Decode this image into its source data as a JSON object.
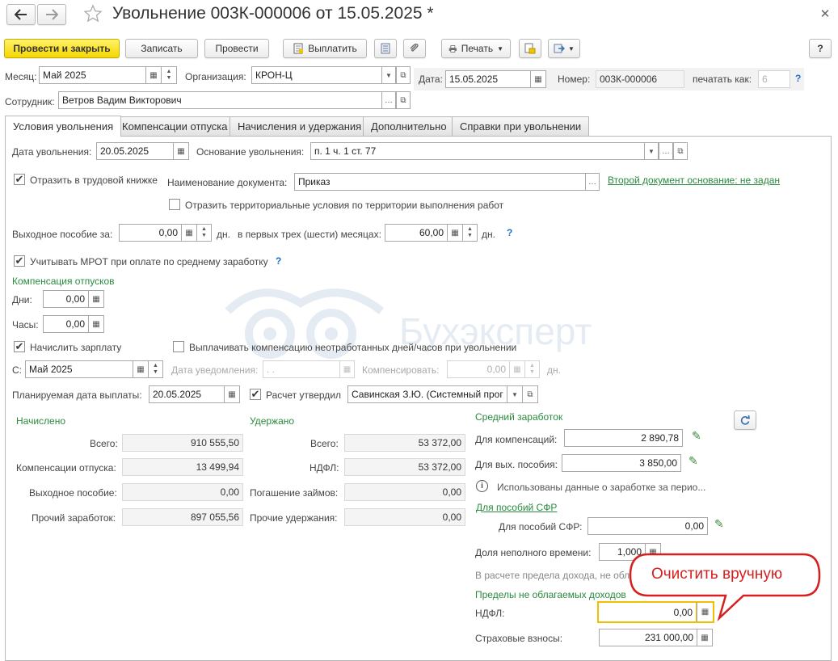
{
  "window": {
    "title": "Увольнение 003К-000006 от 15.05.2025 *"
  },
  "toolbar": {
    "post_close": "Провести и закрыть",
    "save": "Записать",
    "post": "Провести",
    "pay": "Выплатить",
    "print": "Печать",
    "help": "?"
  },
  "header": {
    "month_label": "Месяц:",
    "month_value": "Май 2025",
    "org_label": "Организация:",
    "org_value": "КРОН-Ц",
    "date_label": "Дата:",
    "date_value": "15.05.2025",
    "number_label": "Номер:",
    "number_value": "003К-000006",
    "print_as_label": "печатать как:",
    "print_as_value": "6",
    "help": "?",
    "employee_label": "Сотрудник:",
    "employee_value": "Ветров Вадим Викторович"
  },
  "tabs": [
    {
      "label": "Условия увольнения"
    },
    {
      "label": "Компенсации отпуска"
    },
    {
      "label": "Начисления и удержания"
    },
    {
      "label": "Дополнительно"
    },
    {
      "label": "Справки при увольнении"
    }
  ],
  "conditions": {
    "dismissal_date_label": "Дата увольнения:",
    "dismissal_date_value": "20.05.2025",
    "basis_label": "Основание увольнения:",
    "basis_value": "п. 1 ч. 1 ст. 77",
    "labor_book_label": "Отразить в трудовой книжке",
    "doc_name_label": "Наименование документа:",
    "doc_name_value": "Приказ",
    "second_doc_link": "Второй документ основание: не задан",
    "territorial_label": "Отразить территориальные условия по территории выполнения работ",
    "severance_label": "Выходное пособие за:",
    "severance_value": "0,00",
    "days_unit": "дн.",
    "first_months_label": "в первых трех (шести) месяцах:",
    "first_months_value": "60,00",
    "days_unit2": "дн.",
    "help": "?",
    "mrot_label": "Учитывать МРОТ при оплате по среднему заработку",
    "mrot_help": "?"
  },
  "vacation_comp": {
    "title": "Компенсация отпусков",
    "days_label": "Дни:",
    "days_value": "0,00",
    "hours_label": "Часы:",
    "hours_value": "0,00"
  },
  "salary": {
    "accrue_label": "Начислить зарплату",
    "pay_comp_label": "Выплачивать компенсацию неотработанных дней/часов при увольнении",
    "from_label": "С:",
    "from_value": "Май 2025",
    "notice_date_label": "Дата уведомления:",
    "notice_date_value": " .  .",
    "compensate_label": "Компенсировать:",
    "compensate_value": "0,00",
    "compensate_unit": "дн.",
    "planned_pay_label": "Планируемая дата выплаты:",
    "planned_pay_value": "20.05.2025",
    "approved_label": "Расчет утвердил",
    "approved_value": "Савинская З.Ю. (Системный прог"
  },
  "accrued": {
    "title": "Начислено",
    "total_label": "Всего:",
    "total_value": "910 555,50",
    "vacation_label": "Компенсации отпуска:",
    "vacation_value": "13 499,94",
    "severance_label": "Выходное пособие:",
    "severance_value": "0,00",
    "other_label": "Прочий заработок:",
    "other_value": "897 055,56"
  },
  "withheld": {
    "title": "Удержано",
    "total_label": "Всего:",
    "total_value": "53 372,00",
    "ndfl_label": "НДФЛ:",
    "ndfl_value": "53 372,00",
    "loans_label": "Погашение займов:",
    "loans_value": "0,00",
    "other_label": "Прочие удержания:",
    "other_value": "0,00"
  },
  "average": {
    "title": "Средний заработок",
    "comp_label": "Для компенсаций:",
    "comp_value": "2 890,78",
    "sev_label": "Для вых. пособия:",
    "sev_value": "3 850,00",
    "info_text": "Использованы данные о заработке за перио...",
    "sfr_link": "Для пособий СФР",
    "sfr_label": "Для пособий СФР:",
    "sfr_value": "0,00",
    "part_time_label": "Доля неполного времени:",
    "part_time_value": "1,000",
    "limit_note": "В расчете предела дохода, не облагаемого",
    "limits_title": "Пределы не облагаемых доходов",
    "ndfl_label": "НДФЛ:",
    "ndfl_value": "0,00",
    "insurance_label": "Страховые взносы:",
    "insurance_value": "231 000,00"
  },
  "callout": {
    "text": "Очистить вручную"
  },
  "watermark": {
    "text": "Бухэксперт"
  },
  "colors": {
    "accent_green": "#2a8a3e",
    "primary_button": "#f5d800",
    "callout_red": "#d6201f",
    "focus": "#f0c000"
  }
}
